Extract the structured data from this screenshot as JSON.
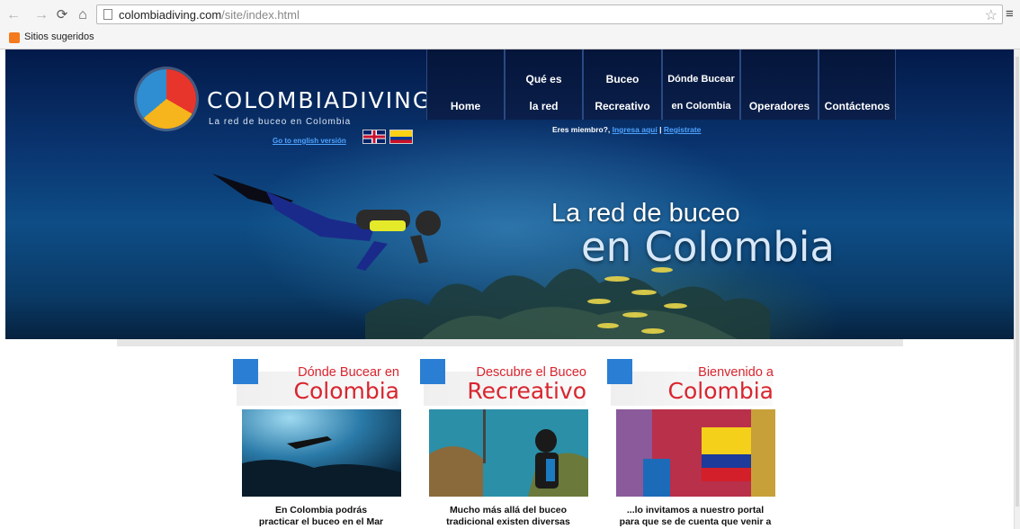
{
  "browser": {
    "url_domain": "colombiadiving.com",
    "url_path": "/site/index.html",
    "bookmark_label": "Sitios sugeridos"
  },
  "site": {
    "logo_title": "COLOMBIADIVING",
    "logo_subtitle": "La red de buceo en Colombia",
    "english_link": "Go to english versión",
    "nav": [
      {
        "label_line1": "Home",
        "label_line2": ""
      },
      {
        "label_line1": "Qué es",
        "label_line2": "la red"
      },
      {
        "label_line1": "Buceo",
        "label_line2": "Recreativo"
      },
      {
        "label_line1": "Dónde Bucear",
        "label_line2": "en Colombia"
      },
      {
        "label_line1": "Operadores",
        "label_line2": ""
      },
      {
        "label_line1": "Contáctenos",
        "label_line2": ""
      }
    ],
    "member_text": "Eres miembro?,",
    "login_link": "Ingresa aquí",
    "separator": "|",
    "register_link": "Registrate",
    "tagline_line1": "La red de buceo",
    "tagline_line2": "en Colombia"
  },
  "cards": [
    {
      "title_small": "Dónde Bucear en",
      "title_big": "Colombia",
      "caption_1": "En Colombia podrás",
      "caption_2": "practicar el buceo en el Mar"
    },
    {
      "title_small": "Descubre el Buceo",
      "title_big": "Recreativo",
      "caption_1": "Mucho más allá del buceo",
      "caption_2": "tradicional existen diversas"
    },
    {
      "title_small": "Bienvenido a",
      "title_big": "Colombia",
      "caption_1": "...lo invitamos a nuestro portal",
      "caption_2": "para que se de cuenta que venir a"
    }
  ],
  "colors": {
    "accent_blue": "#2a7fd4",
    "title_red": "#d9252f",
    "banner_dark": "#031a4a"
  },
  "icons": [
    "back-icon",
    "forward-icon",
    "reload-icon",
    "home-icon",
    "page-icon",
    "star-icon",
    "menu-icon",
    "bookmark-icon"
  ]
}
